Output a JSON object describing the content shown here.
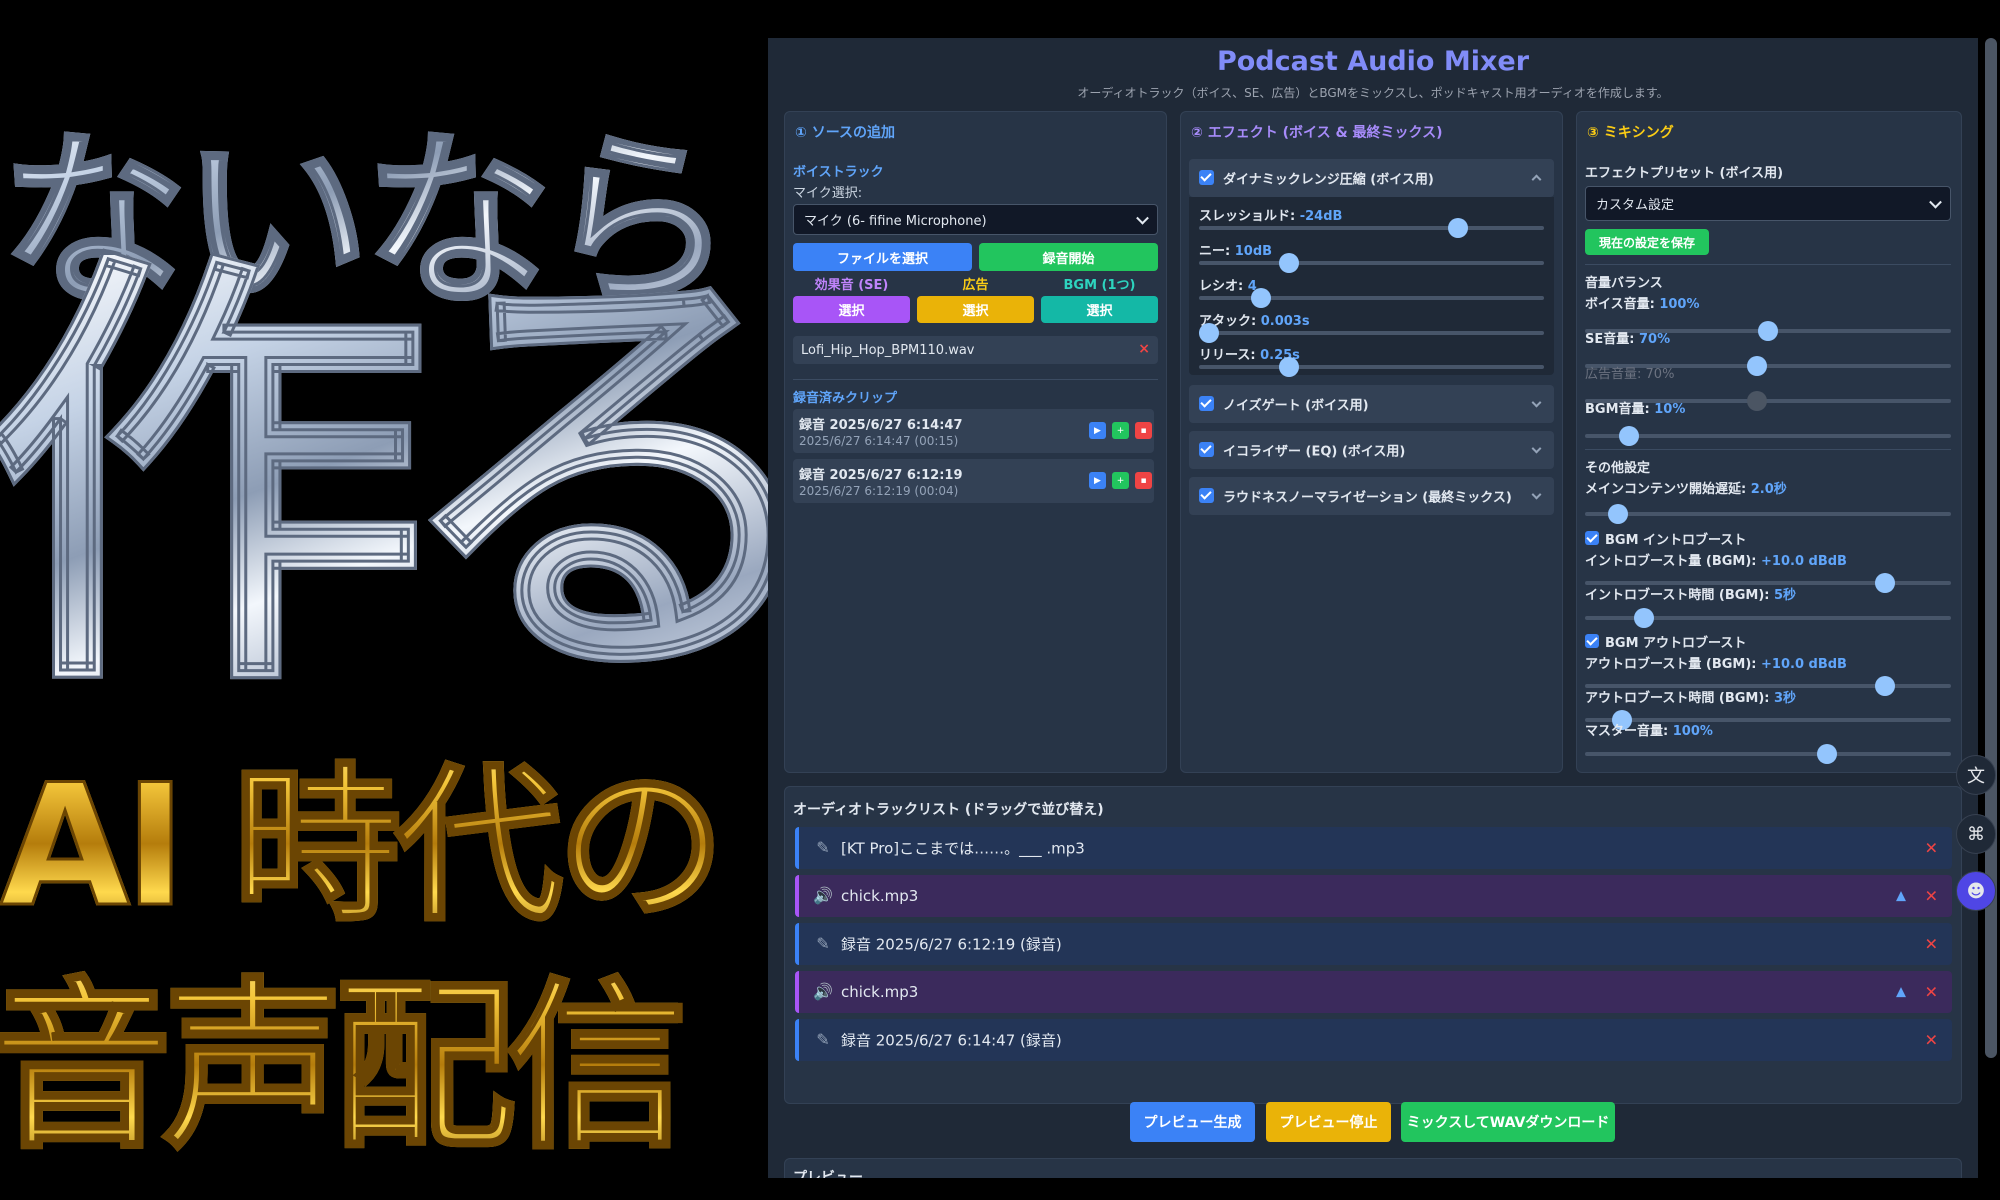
{
  "art": {
    "line1": "ないなら",
    "line2": "作る",
    "line3": "AI 時代の",
    "line4": "音声配信"
  },
  "app": {
    "title": "Podcast Audio Mixer",
    "subtitle": "オーディオトラック（ボイス、SE、広告）とBGMをミックスし、ポッドキャスト用オーディオを作成します。"
  },
  "source": {
    "heading": "① ソースの追加",
    "voice_track_label": "ボイストラック",
    "mic_label": "マイク選択:",
    "mic_value": "マイク (6- fifine Microphone)",
    "file_button": "ファイルを選択",
    "record_button": "録音開始",
    "se_label": "効果音 (SE)",
    "ad_label": "広告",
    "bgm_label": "BGM (1つ)",
    "select_label": "選択",
    "bgm_file": "Lofi_Hip_Hop_BPM110.wav",
    "clips_label": "録音済みクリップ",
    "clips": [
      {
        "title": "録音 2025/6/27 6:14:47",
        "sub": "2025/6/27 6:14:47 (00:15)"
      },
      {
        "title": "録音 2025/6/27 6:12:19",
        "sub": "2025/6/27 6:12:19 (00:04)"
      }
    ]
  },
  "effects": {
    "heading": "② エフェクト (ボイス & 最終ミックス)",
    "compressor": {
      "title": "ダイナミックレンジ圧縮 (ボイス用)",
      "threshold_label": "スレッショルド:",
      "threshold_value": "-24dB",
      "threshold_pos": 0.75,
      "knee_label": "ニー:",
      "knee_value": "10dB",
      "knee_pos": 0.26,
      "ratio_label": "レシオ:",
      "ratio_value": "4",
      "ratio_pos": 0.18,
      "attack_label": "アタック:",
      "attack_value": "0.003s",
      "attack_pos": 0.03,
      "release_label": "リリース:",
      "release_value": "0.25s",
      "release_pos": 0.26
    },
    "noise_gate": "ノイズゲート (ボイス用)",
    "eq": "イコライザー (EQ) (ボイス用)",
    "loudness": "ラウドネスノーマライゼーション (最終ミックス)"
  },
  "mixing": {
    "heading": "③ ミキシング",
    "preset_label": "エフェクトプリセット (ボイス用)",
    "preset_value": "カスタム設定",
    "save_button": "現在の設定を保存",
    "balance_label": "音量バランス",
    "voice_label": "ボイス音量:",
    "voice_value": "100%",
    "voice_pos": 0.5,
    "se_label": "SE音量:",
    "se_value": "70%",
    "se_pos": 0.47,
    "ad_label": "広告音量:",
    "ad_value": "70%",
    "ad_pos": 0.47,
    "bgm_label": "BGM音量:",
    "bgm_value": "10%",
    "bgm_pos": 0.12,
    "other_label": "その他設定",
    "delay_label": "メインコンテンツ開始遅延:",
    "delay_value": "2.0秒",
    "delay_pos": 0.09,
    "intro_boost": "BGM イントロブースト",
    "intro_amount_label": "イントロブースト量 (BGM):",
    "intro_amount_value": "+10.0 dBdB",
    "intro_amount_pos": 0.82,
    "intro_time_label": "イントロブースト時間 (BGM):",
    "intro_time_value": "5秒",
    "intro_time_pos": 0.16,
    "outro_boost": "BGM アウトロブースト",
    "outro_amount_label": "アウトロブースト量 (BGM):",
    "outro_amount_value": "+10.0 dBdB",
    "outro_amount_pos": 0.82,
    "outro_time_label": "アウトロブースト時間 (BGM):",
    "outro_time_value": "3秒",
    "outro_time_pos": 0.1,
    "master_label": "マスター音量:",
    "master_value": "100%",
    "master_pos": 0.66
  },
  "tracklist": {
    "heading": "オーディオトラックリスト (ドラッグで並び替え)",
    "tracks": [
      {
        "name": "[KT Pro]ここまでは……。___ .mp3",
        "kind": "voice"
      },
      {
        "name": "chick.mp3",
        "kind": "se"
      },
      {
        "name": "録音 2025/6/27 6:12:19 (録音)",
        "kind": "voice"
      },
      {
        "name": "chick.mp3",
        "kind": "se"
      },
      {
        "name": "録音 2025/6/27 6:14:47 (録音)",
        "kind": "voice"
      }
    ]
  },
  "actions": {
    "preview": "プレビュー生成",
    "stop": "プレビュー停止",
    "download": "ミックスしてWAVダウンロード"
  },
  "preview_label": "プレビュー",
  "colors": {
    "accent": "#818cf8",
    "primary": "#3b82f6",
    "success": "#22c55e",
    "warning": "#eab308",
    "danger": "#ef4444"
  }
}
